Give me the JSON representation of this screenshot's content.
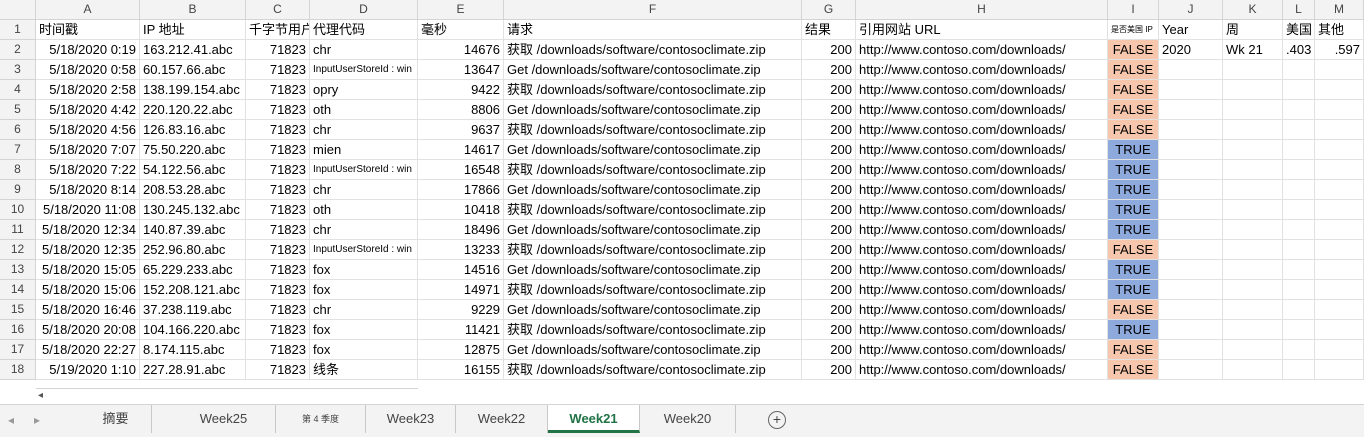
{
  "columns": [
    "A",
    "B",
    "C",
    "D",
    "E",
    "F",
    "G",
    "H",
    "I",
    "J",
    "K",
    "L",
    "M"
  ],
  "header_row": [
    "时间戳",
    "IP 地址",
    "千字节用户",
    "代理代码",
    "毫秒",
    "请求",
    "结果",
    "引用网站 URL",
    "是否美国 IP",
    "Year",
    "周",
    "美国",
    "其他"
  ],
  "rows": [
    {
      "num": "2",
      "a": "5/18/2020 0:19",
      "b": "163.212.41.abc",
      "c": "71823",
      "d": "chr",
      "e": "14676",
      "f": "获取 /downloads/software/contosoclimate.zip",
      "g": "200",
      "h": "http://www.contoso.com/downloads/",
      "i": "FALSE",
      "j": "2020",
      "k": "Wk 21",
      "l": ".403",
      "m": ".597"
    },
    {
      "num": "3",
      "a": "5/18/2020 0:58",
      "b": "60.157.66.abc",
      "c": "71823",
      "d": "InputUserStoreId : win",
      "e": "13647",
      "f": "Get /downloads/software/contosoclimate.zip",
      "g": "200",
      "h": "http://www.contoso.com/downloads/",
      "i": "FALSE",
      "j": "",
      "k": "",
      "l": "",
      "m": ""
    },
    {
      "num": "4",
      "a": "5/18/2020 2:58",
      "b": "138.199.154.abc",
      "c": "71823",
      "d": "opry",
      "e": "9422",
      "f": "获取 /downloads/software/contosoclimate.zip",
      "g": "200",
      "h": "http://www.contoso.com/downloads/",
      "i": "FALSE",
      "j": "",
      "k": "",
      "l": "",
      "m": ""
    },
    {
      "num": "5",
      "a": "5/18/2020 4:42",
      "b": "220.120.22.abc",
      "c": "71823",
      "d": "oth",
      "e": "8806",
      "f": "Get /downloads/software/contosoclimate.zip",
      "g": "200",
      "h": "http://www.contoso.com/downloads/",
      "i": "FALSE",
      "j": "",
      "k": "",
      "l": "",
      "m": ""
    },
    {
      "num": "6",
      "a": "5/18/2020 4:56",
      "b": "126.83.16.abc",
      "c": "71823",
      "d": "chr",
      "e": "9637",
      "f": "获取 /downloads/software/contosoclimate.zip",
      "g": "200",
      "h": "http://www.contoso.com/downloads/",
      "i": "FALSE",
      "j": "",
      "k": "",
      "l": "",
      "m": ""
    },
    {
      "num": "7",
      "a": "5/18/2020 7:07",
      "b": "75.50.220.abc",
      "c": "71823",
      "d": "mien",
      "e": "14617",
      "f": "Get /downloads/software/contosoclimate.zip",
      "g": "200",
      "h": "http://www.contoso.com/downloads/",
      "i": "TRUE",
      "j": "",
      "k": "",
      "l": "",
      "m": ""
    },
    {
      "num": "8",
      "a": "5/18/2020 7:22",
      "b": "54.122.56.abc",
      "c": "71823",
      "d": "InputUserStoreId : win",
      "e": "16548",
      "f": "获取 /downloads/software/contosoclimate.zip",
      "g": "200",
      "h": "http://www.contoso.com/downloads/",
      "i": "TRUE",
      "j": "",
      "k": "",
      "l": "",
      "m": ""
    },
    {
      "num": "9",
      "a": "5/18/2020 8:14",
      "b": "208.53.28.abc",
      "c": "71823",
      "d": "chr",
      "e": "17866",
      "f": "Get /downloads/software/contosoclimate.zip",
      "g": "200",
      "h": "http://www.contoso.com/downloads/",
      "i": "TRUE",
      "j": "",
      "k": "",
      "l": "",
      "m": ""
    },
    {
      "num": "10",
      "a": "5/18/2020 11:08",
      "b": "130.245.132.abc",
      "c": "71823",
      "d": "oth",
      "e": "10418",
      "f": "获取 /downloads/software/contosoclimate.zip",
      "g": "200",
      "h": "http://www.contoso.com/downloads/",
      "i": "TRUE",
      "j": "",
      "k": "",
      "l": "",
      "m": ""
    },
    {
      "num": "11",
      "a": "5/18/2020 12:34",
      "b": "140.87.39.abc",
      "c": "71823",
      "d": "chr",
      "e": "18496",
      "f": "Get /downloads/software/contosoclimate.zip",
      "g": "200",
      "h": "http://www.contoso.com/downloads/",
      "i": "TRUE",
      "j": "",
      "k": "",
      "l": "",
      "m": ""
    },
    {
      "num": "12",
      "a": "5/18/2020 12:35",
      "b": "252.96.80.abc",
      "c": "71823",
      "d": "InputUserStoreId : win",
      "e": "13233",
      "f": "获取 /downloads/software/contosoclimate.zip",
      "g": "200",
      "h": "http://www.contoso.com/downloads/",
      "i": "FALSE",
      "j": "",
      "k": "",
      "l": "",
      "m": ""
    },
    {
      "num": "13",
      "a": "5/18/2020 15:05",
      "b": "65.229.233.abc",
      "c": "71823",
      "d": "fox",
      "e": "14516",
      "f": "Get /downloads/software/contosoclimate.zip",
      "g": "200",
      "h": "http://www.contoso.com/downloads/",
      "i": "TRUE",
      "j": "",
      "k": "",
      "l": "",
      "m": ""
    },
    {
      "num": "14",
      "a": "5/18/2020 15:06",
      "b": "152.208.121.abc",
      "c": "71823",
      "d": "fox",
      "e": "14971",
      "f": "获取 /downloads/software/contosoclimate.zip",
      "g": "200",
      "h": "http://www.contoso.com/downloads/",
      "i": "TRUE",
      "j": "",
      "k": "",
      "l": "",
      "m": ""
    },
    {
      "num": "15",
      "a": "5/18/2020 16:46",
      "b": "37.238.119.abc",
      "c": "71823",
      "d": "chr",
      "e": "9229",
      "f": "Get /downloads/software/contosoclimate.zip",
      "g": "200",
      "h": "http://www.contoso.com/downloads/",
      "i": "FALSE",
      "j": "",
      "k": "",
      "l": "",
      "m": ""
    },
    {
      "num": "16",
      "a": "5/18/2020 20:08",
      "b": "104.166.220.abc",
      "c": "71823",
      "d": "fox",
      "e": "11421",
      "f": "获取 /downloads/software/contosoclimate.zip",
      "g": "200",
      "h": "http://www.contoso.com/downloads/",
      "i": "TRUE",
      "j": "",
      "k": "",
      "l": "",
      "m": ""
    },
    {
      "num": "17",
      "a": "5/18/2020 22:27",
      "b": "8.174.115.abc",
      "c": "71823",
      "d": "fox",
      "e": "12875",
      "f": "Get /downloads/software/contosoclimate.zip",
      "g": "200",
      "h": "http://www.contoso.com/downloads/",
      "i": "FALSE",
      "j": "",
      "k": "",
      "l": "",
      "m": ""
    },
    {
      "num": "18",
      "a": "5/19/2020 1:10",
      "b": "227.28.91.abc",
      "c": "71823",
      "d": "线条",
      "e": "16155",
      "f": "获取 /downloads/software/contosoclimate.zip",
      "g": "200",
      "h": "http://www.contoso.com/downloads/",
      "i": "FALSE",
      "j": "",
      "k": "",
      "l": "",
      "m": ""
    }
  ],
  "tabs": [
    {
      "label": "摘要",
      "active": false
    },
    {
      "label": "Week25",
      "active": false
    },
    {
      "label": "第 4 季度",
      "active": false
    },
    {
      "label": "Week23",
      "active": false
    },
    {
      "label": "Week22",
      "active": false
    },
    {
      "label": "Week21",
      "active": true
    },
    {
      "label": "Week20",
      "active": false
    }
  ],
  "icons": {
    "scroll_left": "left-arrow-icon",
    "add_sheet": "plus-icon"
  },
  "colors": {
    "false_fill": "#f7c7ad",
    "true_fill": "#8ea9db",
    "active_tab": "#217346"
  }
}
